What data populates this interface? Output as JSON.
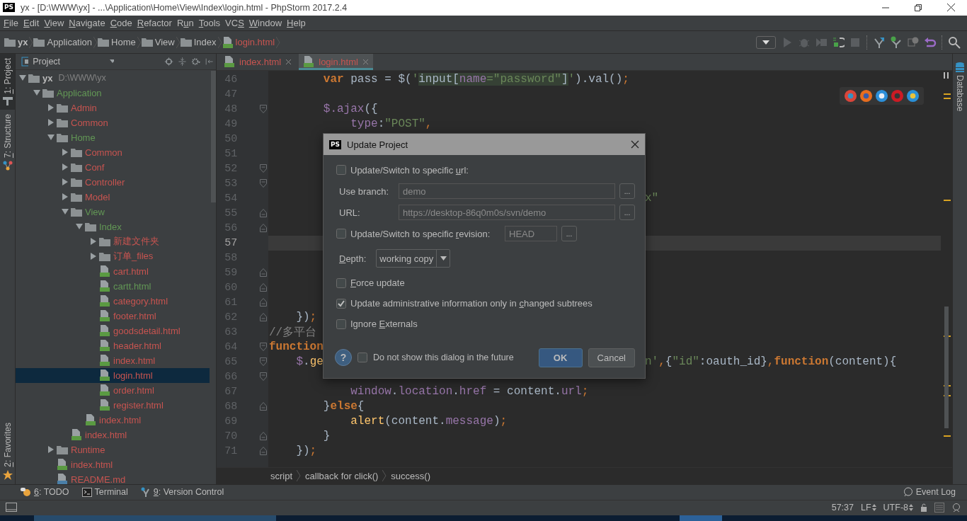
{
  "window": {
    "app_badge": "PS",
    "title": "yx - [D:\\WWW\\yx] - ...\\Application\\Home\\View\\Index\\login.html - PhpStorm 2017.2.4"
  },
  "menu": [
    {
      "key": "F",
      "post": "ile"
    },
    {
      "key": "E",
      "post": "dit"
    },
    {
      "key": "V",
      "post": "iew"
    },
    {
      "key": "N",
      "post": "avigate"
    },
    {
      "key": "C",
      "post": "ode"
    },
    {
      "key": "R",
      "post": "efactor"
    },
    {
      "pre": "R",
      "key": "u",
      "post": "n"
    },
    {
      "key": "T",
      "post": "ools"
    },
    {
      "pre": "VC",
      "key": "S"
    },
    {
      "key": "W",
      "post": "indow"
    },
    {
      "key": "H",
      "post": "elp"
    }
  ],
  "breadcrumbs": [
    {
      "label": "yx",
      "kind": "module"
    },
    {
      "label": "Application",
      "kind": "folder"
    },
    {
      "label": "Home",
      "kind": "folder"
    },
    {
      "label": "View",
      "kind": "folder"
    },
    {
      "label": "Index",
      "kind": "folder"
    },
    {
      "label": "login.html",
      "kind": "html"
    }
  ],
  "left_tool_windows": [
    {
      "label": {
        "key": "1",
        "post": ": Project"
      },
      "selected": true
    },
    {
      "label": {
        "key": "7",
        "post": ": Structure"
      },
      "selected": false
    }
  ],
  "left_bottom_tool_windows": [
    {
      "label": {
        "key": "2",
        "post": ": Favorites"
      },
      "selected": false
    }
  ],
  "project_panel": {
    "title": "Project",
    "tree": [
      {
        "label": "yx",
        "path": "D:\\WWW\\yx",
        "kind": "module",
        "color": "#bbbbbb",
        "expanded": true,
        "selected": false,
        "children": [
          {
            "label": "Application",
            "kind": "folder",
            "color": "#629755",
            "expanded": true,
            "selected": false,
            "children": [
              {
                "label": "Admin",
                "kind": "folder",
                "color": "#c75450",
                "expanded": false,
                "selected": false
              },
              {
                "label": "Common",
                "kind": "folder",
                "color": "#c75450",
                "expanded": false,
                "selected": false
              },
              {
                "label": "Home",
                "kind": "folder",
                "color": "#629755",
                "expanded": true,
                "selected": false,
                "children": [
                  {
                    "label": "Common",
                    "kind": "folder",
                    "color": "#c75450",
                    "expanded": false,
                    "selected": false
                  },
                  {
                    "label": "Conf",
                    "kind": "folder",
                    "color": "#c75450",
                    "expanded": false,
                    "selected": false
                  },
                  {
                    "label": "Controller",
                    "kind": "folder",
                    "color": "#c75450",
                    "expanded": false,
                    "selected": false
                  },
                  {
                    "label": "Model",
                    "kind": "folder",
                    "color": "#c75450",
                    "expanded": false,
                    "selected": false
                  },
                  {
                    "label": "View",
                    "kind": "folder",
                    "color": "#629755",
                    "expanded": true,
                    "selected": false,
                    "children": [
                      {
                        "label": "Index",
                        "kind": "folder",
                        "color": "#629755",
                        "expanded": true,
                        "selected": false,
                        "children": [
                          {
                            "label": "新建文件夹",
                            "kind": "folder",
                            "color": "#c75450",
                            "expanded": false,
                            "selected": false
                          },
                          {
                            "label": "订单_files",
                            "kind": "folder",
                            "color": "#c75450",
                            "expanded": false,
                            "selected": false
                          },
                          {
                            "label": "cart.html",
                            "kind": "html",
                            "color": "#c75450",
                            "selected": false
                          },
                          {
                            "label": "cartt.html",
                            "kind": "html",
                            "color": "#629755",
                            "selected": false
                          },
                          {
                            "label": "category.html",
                            "kind": "html",
                            "color": "#c75450",
                            "selected": false
                          },
                          {
                            "label": "footer.html",
                            "kind": "html",
                            "color": "#c75450",
                            "selected": false
                          },
                          {
                            "label": "goodsdetail.html",
                            "kind": "html",
                            "color": "#c75450",
                            "selected": false
                          },
                          {
                            "label": "header.html",
                            "kind": "html",
                            "color": "#c75450",
                            "selected": false
                          },
                          {
                            "label": "index.html",
                            "kind": "html",
                            "color": "#c75450",
                            "selected": false
                          },
                          {
                            "label": "login.html",
                            "kind": "html",
                            "color": "#c75450",
                            "selected": true
                          },
                          {
                            "label": "order.html",
                            "kind": "html",
                            "color": "#c75450",
                            "selected": false
                          },
                          {
                            "label": "register.html",
                            "kind": "html",
                            "color": "#c75450",
                            "selected": false
                          }
                        ]
                      },
                      {
                        "label": "index.html",
                        "kind": "html",
                        "color": "#c75450",
                        "selected": false
                      }
                    ]
                  },
                  {
                    "label": "index.html",
                    "kind": "html",
                    "color": "#c75450",
                    "selected": false
                  }
                ]
              },
              {
                "label": "Runtime",
                "kind": "folder",
                "color": "#c75450",
                "expanded": false,
                "selected": false
              },
              {
                "label": "index.html",
                "kind": "html",
                "color": "#c75450",
                "selected": false
              },
              {
                "label": "README.md",
                "kind": "md",
                "color": "#c75450",
                "selected": false
              }
            ]
          }
        ]
      }
    ]
  },
  "editor": {
    "tabs": [
      {
        "label": "index.html",
        "selected": false
      },
      {
        "label": "login.html",
        "selected": true
      }
    ],
    "lines": [
      {
        "number": "46",
        "current": false,
        "left": [
          {
            "kind": "kw",
            "text": "        var"
          },
          {
            "kind": "pl",
            "text": " pass = $("
          },
          {
            "kind": "str",
            "text": "'"
          },
          {
            "kind": "inj",
            "text": "input["
          },
          {
            "kind": "injp",
            "text": "name"
          },
          {
            "kind": "injs",
            "text": "=\"password\""
          },
          {
            "kind": "inj",
            "text": "]"
          },
          {
            "kind": "str",
            "text": "'"
          },
          {
            "kind": "pl",
            "text": ").val()"
          },
          {
            "kind": "op",
            "text": ";"
          }
        ]
      },
      {
        "number": "47",
        "current": false
      },
      {
        "number": "48",
        "kind": "opener",
        "current": false,
        "left": [
          {
            "kind": "prop",
            "text": "        $.ajax"
          },
          {
            "kind": "pl",
            "text": "({"
          }
        ]
      },
      {
        "number": "49",
        "current": false,
        "left": [
          {
            "kind": "prop",
            "text": "            type"
          },
          {
            "kind": "pl",
            "text": ":"
          },
          {
            "kind": "str",
            "text": "\"POST\""
          },
          {
            "kind": "op",
            "text": ","
          }
        ]
      },
      {
        "number": "50",
        "current": false
      },
      {
        "number": "51",
        "current": false
      },
      {
        "number": "52",
        "kind": "opener",
        "current": false
      },
      {
        "number": "53",
        "kind": "opener",
        "current": false
      },
      {
        "number": "54",
        "current": false,
        "right": [
          {
            "kind": "str",
            "text": "x\""
          }
        ]
      },
      {
        "number": "55",
        "kind": "closer",
        "current": false
      },
      {
        "number": "56",
        "kind": "closer",
        "current": false
      },
      {
        "number": "57",
        "current": true
      },
      {
        "number": "58",
        "current": false
      },
      {
        "number": "59",
        "kind": "closer",
        "current": false
      },
      {
        "number": "60",
        "kind": "closer",
        "current": false
      },
      {
        "number": "61",
        "kind": "closer",
        "current": false
      },
      {
        "number": "62",
        "kind": "closer",
        "current": false,
        "left": [
          {
            "kind": "pl",
            "text": "    })"
          },
          {
            "kind": "op",
            "text": ";"
          }
        ]
      },
      {
        "number": "63",
        "current": false,
        "left": [
          {
            "kind": "com",
            "text": "//多平台"
          }
        ]
      },
      {
        "number": "64",
        "kind": "opener",
        "current": false,
        "left": [
          {
            "kind": "kw",
            "text": "function"
          }
        ]
      },
      {
        "number": "65",
        "kind": "opener",
        "current": false,
        "left": [
          {
            "kind": "prop",
            "text": "    $"
          },
          {
            "kind": "pl",
            "text": "."
          },
          {
            "kind": "fn",
            "text": "ge"
          }
        ],
        "right": [
          {
            "kind": "str",
            "text": "n'"
          },
          {
            "kind": "op",
            "text": ","
          },
          {
            "kind": "pl",
            "text": "{"
          },
          {
            "kind": "str",
            "text": "\"id\""
          },
          {
            "kind": "pl",
            "text": ":oauth_id}"
          },
          {
            "kind": "op",
            "text": ","
          },
          {
            "kind": "kw",
            "text": "function"
          },
          {
            "kind": "pl",
            "text": "(content){"
          }
        ]
      },
      {
        "number": "66",
        "kind": "opener",
        "current": false
      },
      {
        "number": "67",
        "current": false,
        "left": [
          {
            "kind": "prop",
            "text": "            window"
          },
          {
            "kind": "pl",
            "text": "."
          },
          {
            "kind": "prop",
            "text": "location"
          },
          {
            "kind": "pl",
            "text": "."
          },
          {
            "kind": "prop",
            "text": "href"
          },
          {
            "kind": "pl",
            "text": " = content."
          },
          {
            "kind": "prop",
            "text": "url"
          },
          {
            "kind": "op",
            "text": ";"
          }
        ]
      },
      {
        "number": "68",
        "kind": "closer",
        "current": false,
        "left": [
          {
            "kind": "pl",
            "text": "        }"
          },
          {
            "kind": "kw",
            "text": "else"
          },
          {
            "kind": "pl",
            "text": "{"
          }
        ]
      },
      {
        "number": "69",
        "current": false,
        "left": [
          {
            "kind": "fn",
            "text": "            alert"
          },
          {
            "kind": "pl",
            "text": "(content."
          },
          {
            "kind": "prop",
            "text": "message"
          },
          {
            "kind": "pl",
            "text": ")"
          },
          {
            "kind": "op",
            "text": ";"
          }
        ]
      },
      {
        "number": "70",
        "kind": "closer",
        "current": false,
        "left": [
          {
            "kind": "pl",
            "text": "        }"
          }
        ]
      },
      {
        "number": "71",
        "kind": "closer",
        "current": false,
        "left": [
          {
            "kind": "pl",
            "text": "    })"
          },
          {
            "kind": "op",
            "text": ";"
          }
        ]
      }
    ],
    "breadcrumbs": [
      "script",
      "callback for click()",
      "success()"
    ]
  },
  "right_tool_windows": [
    {
      "label": "Database",
      "selected": false
    }
  ],
  "dialog": {
    "app_badge": "PS",
    "title": "Update Project",
    "url_switch": {
      "label": {
        "pre": "Update/Switch to specific ",
        "key": "u",
        "post": "rl:"
      },
      "checked": false
    },
    "branch": {
      "label": "Use branch:",
      "value": "demo",
      "browse": "..."
    },
    "url": {
      "label": "URL:",
      "value": "https://desktop-86q0m0s/svn/demo",
      "browse": "..."
    },
    "revision_switch": {
      "label": {
        "pre": "Update/Switch to specific ",
        "key": "r",
        "post": "evision:"
      },
      "checked": false,
      "value": "HEAD",
      "browse": "..."
    },
    "depth": {
      "label": {
        "key": "D",
        "post": "epth:"
      },
      "value": "working copy"
    },
    "options": [
      {
        "label": {
          "key": "F",
          "post": "orce update"
        },
        "checked": false
      },
      {
        "label": {
          "pre": "Update administrative information only in ",
          "key": "c",
          "post": "hanged subtrees"
        },
        "checked": true
      },
      {
        "label": {
          "pre": "Ignore ",
          "key": "E",
          "post": "xternals"
        },
        "checked": false
      }
    ],
    "help": "?",
    "dont_show": {
      "label": "Do not show this dialog in the future",
      "checked": false
    },
    "buttons": [
      {
        "label": "OK",
        "kind": "default"
      },
      {
        "label": "Cancel",
        "kind": "normal"
      }
    ]
  },
  "bottom_tool_windows": [
    {
      "label": {
        "key": "6",
        "post": ": TODO"
      },
      "kind": "todo"
    },
    {
      "label": {
        "pre": "Terminal"
      },
      "kind": "terminal"
    },
    {
      "label": {
        "key": "9",
        "post": ": Version Control"
      },
      "kind": "vcs"
    }
  ],
  "event_log": "Event Log",
  "status_bar": {
    "position": "57:37",
    "line_separator": "LF",
    "encoding": "UTF-8"
  }
}
